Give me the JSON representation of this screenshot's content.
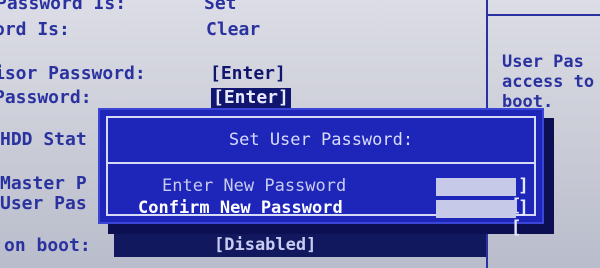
{
  "settings": {
    "rows": [
      {
        "label": "Password Is:",
        "value": "Set"
      },
      {
        "label": "ord Is:",
        "value": "Clear"
      },
      {
        "label": "isor Password:",
        "value": "[Enter]"
      },
      {
        "label": "Password:",
        "value": "[Enter]"
      },
      {
        "label": "HDD Stat",
        "value": ""
      },
      {
        "label": "Master P",
        "value": ""
      },
      {
        "label": "User Pas",
        "value": ""
      },
      {
        "label": "on boot:",
        "value": "[Disabled]"
      }
    ]
  },
  "help": {
    "lines": [
      "User Pas",
      "access to",
      "boot."
    ]
  },
  "dialog": {
    "title": "Set User Password:",
    "enter_label": "Enter New Password",
    "confirm_label": "Confirm New Password",
    "field_left": "[",
    "field_right": "]"
  },
  "colors": {
    "background": "#cdcfd9",
    "bios_blue_text": "#2a32a0",
    "dialog_blue": "#1d26b8",
    "selection": "#10166e"
  }
}
